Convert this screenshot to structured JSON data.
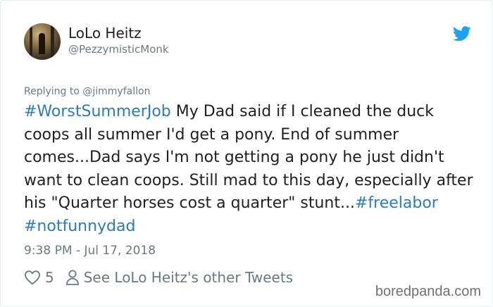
{
  "tweet": {
    "author_name": "LoLo Heitz",
    "author_handle": "@PezzymisticMonk",
    "replying_to": "Replying to @jimmyfallon",
    "body_parts": [
      {
        "text": "#WorstSummerJob",
        "hashtag": true
      },
      {
        "text": " My Dad said if I cleaned the duck coops all summer I'd get a pony. End of summer comes...Dad says I'm not getting a pony he just didn't want to clean coops. Still mad to this day, especially after his \"Quarter horses cost a quarter\" stunt...",
        "hashtag": false
      },
      {
        "text": "#freelabor",
        "hashtag": true
      },
      {
        "text": " ",
        "hashtag": false
      },
      {
        "text": "#notfunnydad",
        "hashtag": true
      }
    ],
    "timestamp": "9:38 PM - Jul 17, 2018",
    "like_count": "5",
    "other_tweets_link": "See LoLo Heitz's other Tweets"
  },
  "icons": {
    "brand": "twitter-bird-icon",
    "like": "heart-icon",
    "profile": "person-icon"
  },
  "colors": {
    "hashtag": "#2b7bb9",
    "twitter_blue": "#1da1f2",
    "meta_text": "#697882",
    "body_text": "#1c2022"
  },
  "watermark": "boredpanda.com"
}
